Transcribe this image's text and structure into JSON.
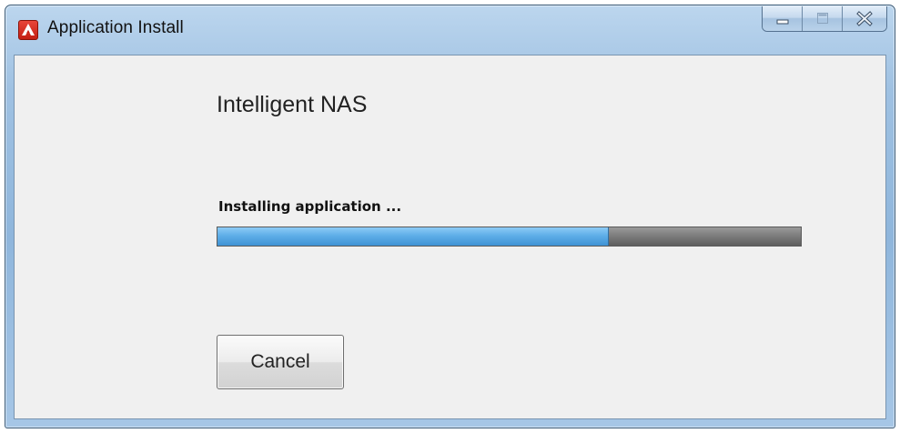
{
  "window": {
    "title": "Application Install",
    "icon": "adobe-air-icon",
    "caption_buttons": [
      "minimize",
      "maximize",
      "close"
    ]
  },
  "content": {
    "app_name": "Intelligent NAS",
    "status": "Installing application ...",
    "progress_fraction": 0.67,
    "cancel_label": "Cancel"
  },
  "colors": {
    "progress_fill": "#5eaee8",
    "progress_track": "#7d7d7d",
    "titlebar": "#9fc1e2",
    "client_bg": "#f0f0f0"
  }
}
